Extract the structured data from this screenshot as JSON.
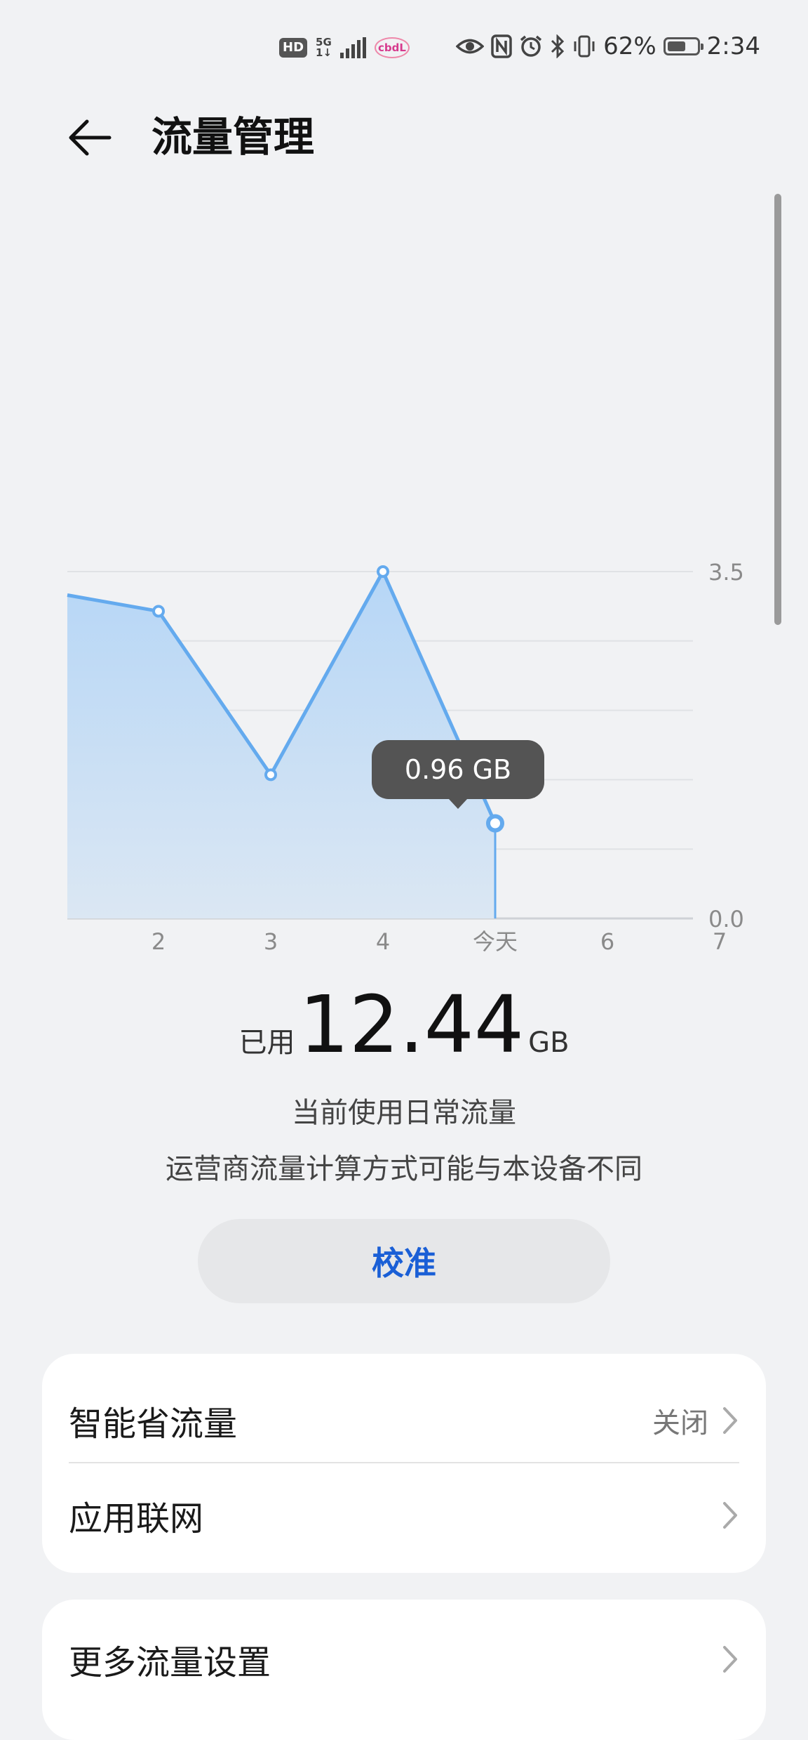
{
  "status_bar": {
    "hd": "HD",
    "network": "5G",
    "network_sub": "1↓",
    "carrier": "cbdL",
    "battery": "62%",
    "time": "2:34",
    "battery_level": 0.62
  },
  "header": {
    "title": "流量管理"
  },
  "chart_data": {
    "type": "area",
    "x_labels": [
      "2",
      "3",
      "4",
      "今天",
      "6",
      "7"
    ],
    "y_tick_labels": [
      "3.5",
      "0.0"
    ],
    "ylim": [
      0,
      3.5
    ],
    "series": [
      {
        "x": [
          "1",
          "2",
          "3",
          "4",
          "今天"
        ],
        "values": [
          3.3,
          3.1,
          1.45,
          3.5,
          0.96
        ]
      }
    ],
    "selected": {
      "x": "今天",
      "value": 0.96,
      "label": "0.96 GB"
    },
    "grid": true,
    "colors": {
      "line": "#64aaee",
      "fill_top": "#b6d6f6",
      "fill_bottom": "#dbe7f3"
    }
  },
  "usage": {
    "prefix": "已用",
    "amount": "12.44",
    "unit": "GB",
    "line1": "当前使用日常流量",
    "line2": "运营商流量计算方式可能与本设备不同"
  },
  "calibrate": {
    "label": "校准",
    "color": "#1a5fd6"
  },
  "settings": {
    "smart_saver": {
      "label": "智能省流量",
      "value": "关闭"
    },
    "app_network": {
      "label": "应用联网"
    },
    "more": {
      "label": "更多流量设置"
    }
  }
}
